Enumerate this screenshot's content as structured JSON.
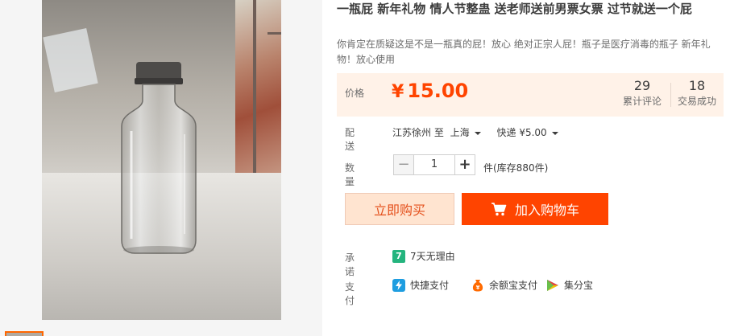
{
  "product": {
    "title": "一瓶屁 新年礼物 情人节整蛊 送老师送前男票女票 过节就送一个屁",
    "subtitle": "你肯定在质疑这是不是一瓶真的屁！放心 绝对正宗人屁！瓶子是医疗消毒的瓶子 新年礼物！放心使用"
  },
  "price": {
    "label": "价格",
    "currency": "¥",
    "value": "15.00",
    "reviews_count": "29",
    "reviews_label": "累计评论",
    "sales_count": "18",
    "sales_label": "交易成功"
  },
  "delivery": {
    "label": "配送",
    "origin": "江苏徐州 至",
    "destination": "上海",
    "shipping": "快递 ¥5.00"
  },
  "quantity": {
    "label": "数量",
    "minus": "−",
    "value": "1",
    "plus": "+",
    "stock": "件(库存880件)"
  },
  "actions": {
    "buy_now": "立即购买",
    "add_to_cart": "加入购物车"
  },
  "promise": {
    "label": "承诺",
    "badge": "7",
    "text": "7天无理由"
  },
  "payment": {
    "label": "支付",
    "methods": [
      {
        "icon": "quick-pay-icon",
        "text": "快捷支付"
      },
      {
        "icon": "yuebao-icon",
        "text": "余额宝支付"
      },
      {
        "icon": "jifenbao-icon",
        "text": "集分宝"
      }
    ]
  },
  "colors": {
    "accent": "#ff4400",
    "price_bg": "#fff2e8",
    "buy_bg": "#ffe4d0",
    "promise_green": "#24b47e",
    "quick_pay_blue": "#1e9de0",
    "yuebao_orange": "#ff6a00"
  }
}
